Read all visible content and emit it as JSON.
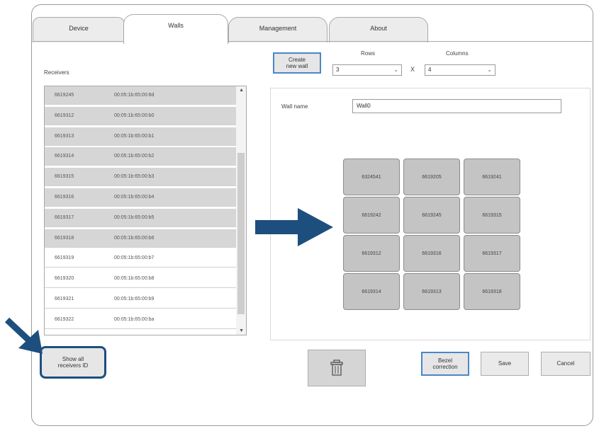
{
  "tabs": [
    {
      "label": "Device",
      "active": false
    },
    {
      "label": "Walls",
      "active": true
    },
    {
      "label": "Management",
      "active": false
    },
    {
      "label": "About",
      "active": false
    }
  ],
  "receivers": {
    "title": "Receivers",
    "rows": [
      {
        "id": "6619245",
        "mac": "00:05:1b:65:00:8d",
        "selected": true
      },
      {
        "id": "6619312",
        "mac": "00:05:1b:65:00:b0",
        "selected": true
      },
      {
        "id": "6619313",
        "mac": "00:05:1b:65:00:b1",
        "selected": true
      },
      {
        "id": "6619314",
        "mac": "00:05:1b:65:00:b2",
        "selected": true
      },
      {
        "id": "6619315",
        "mac": "00:05:1b:65:00:b3",
        "selected": true
      },
      {
        "id": "6619316",
        "mac": "00:05:1b:65:00:b4",
        "selected": true
      },
      {
        "id": "6619317",
        "mac": "00:05:1b:65:00:b5",
        "selected": true
      },
      {
        "id": "6619318",
        "mac": "00:05:1b:65:00:b6",
        "selected": true
      },
      {
        "id": "6619319",
        "mac": "00:05:1b:65:00:b7",
        "selected": false
      },
      {
        "id": "6619320",
        "mac": "00:05:1b:65:00:b8",
        "selected": false
      },
      {
        "id": "6619321",
        "mac": "00:05:1b:65:00:b9",
        "selected": false
      },
      {
        "id": "6619322",
        "mac": "00:05:1b:65:00:ba",
        "selected": false
      }
    ]
  },
  "create_wall_label": "Create new wall",
  "rows_label": "Rows",
  "rows_value": "3",
  "columns_label": "Columns",
  "columns_value": "4",
  "times_symbol": "X",
  "wall_name_label": "Wall name",
  "wall_name_value": "Wall0",
  "wall_cells": [
    "6324541",
    "6619205",
    "6619241",
    "6619242",
    "6619245",
    "6619315",
    "6619312",
    "6619316",
    "6619317",
    "6619314",
    "6619313",
    "6619318"
  ],
  "show_all_label": "Show all receivers ID",
  "bezel_label": "Bezel correction",
  "save_label": "Save",
  "cancel_label": "Cancel",
  "icons": {
    "delete": "trash-icon",
    "arrow_main": "right-arrow-icon",
    "arrow_callout": "diagonal-arrow-icon"
  },
  "colors": {
    "accent": "#4a86c8",
    "arrow": "#1d4f7e",
    "selected_row": "#d6d6d6",
    "cell": "#c4c4c4"
  }
}
